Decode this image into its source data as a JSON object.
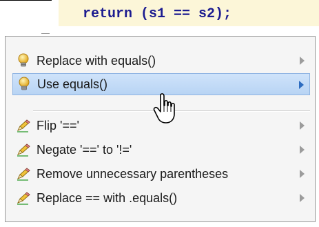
{
  "editor": {
    "code_line": "return (s1 == s2);"
  },
  "menu": {
    "items": [
      {
        "label": "Replace with equals()",
        "icon": "lightbulb-icon",
        "has_submenu": true,
        "selected": false
      },
      {
        "label": "Use equals()",
        "icon": "lightbulb-icon",
        "has_submenu": true,
        "selected": true
      },
      {
        "label": "Flip '=='",
        "icon": "pencil-icon",
        "has_submenu": true,
        "selected": false
      },
      {
        "label": "Negate '==' to '!='",
        "icon": "pencil-icon",
        "has_submenu": true,
        "selected": false
      },
      {
        "label": "Remove unnecessary parentheses",
        "icon": "pencil-icon",
        "has_submenu": true,
        "selected": false
      },
      {
        "label": "Replace == with .equals()",
        "icon": "pencil-icon",
        "has_submenu": true,
        "selected": false
      }
    ]
  },
  "colors": {
    "code_highlight": "#fcf6d8",
    "selection": "#b8d4f4",
    "code_text": "#1b1b90"
  }
}
